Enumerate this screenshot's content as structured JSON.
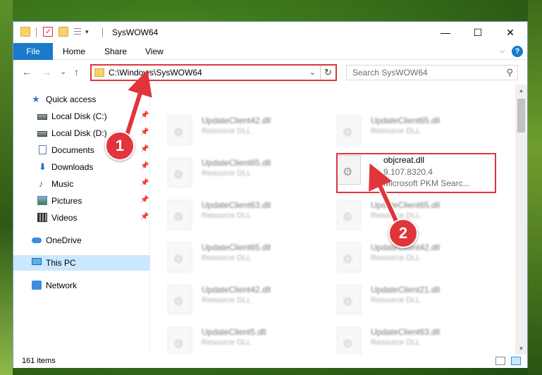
{
  "window": {
    "title": "SysWOW64"
  },
  "titlebar": {
    "minimize": "—",
    "maximize": "☐",
    "close": "✕",
    "qa_dropdown": "▾"
  },
  "ribbon": {
    "tabs": [
      "File",
      "Home",
      "Share",
      "View"
    ],
    "expand": "⌵",
    "help": "?"
  },
  "nav": {
    "back": "←",
    "forward": "→",
    "recent": "⌄",
    "up": "↑"
  },
  "address": {
    "path": "C:\\Windows\\SysWOW64",
    "dropdown": "⌄",
    "refresh": "↻"
  },
  "search": {
    "placeholder": "Search SysWOW64",
    "icon": "⚲"
  },
  "sidebar": {
    "items": [
      {
        "label": "Quick access"
      },
      {
        "label": "Local Disk (C:)"
      },
      {
        "label": "Local Disk (D:)"
      },
      {
        "label": "Documents"
      },
      {
        "label": "Downloads"
      },
      {
        "label": "Music"
      },
      {
        "label": "Pictures"
      },
      {
        "label": "Videos"
      },
      {
        "label": "OneDrive"
      },
      {
        "label": "This PC"
      },
      {
        "label": "Network"
      }
    ],
    "pin": "📌"
  },
  "files": [
    {
      "name": "UpdateClient42.dll",
      "type": "Resource DLL"
    },
    {
      "name": "UpdateClient65.dll",
      "type": "Resource DLL"
    },
    {
      "name": "UpdateClient65.dll",
      "type": "Resource DLL"
    },
    {
      "name": "objcreat.dll",
      "version": "9.107.8320.4",
      "desc": "Microsoft PKM Searc..."
    },
    {
      "name": "UpdateClient63.dll",
      "type": "Resource DLL"
    },
    {
      "name": "UpdateClient65.dll",
      "type": "Resource DLL"
    },
    {
      "name": "UpdateClient65.dll",
      "type": "Resource DLL"
    },
    {
      "name": "UpdateClient42.dll",
      "type": "Resource DLL"
    },
    {
      "name": "UpdateClient42.dll",
      "type": "Resource DLL"
    },
    {
      "name": "UpdateClient21.dll",
      "type": "Resource DLL"
    },
    {
      "name": "UpdateClient5.dll",
      "type": "Resource DLL"
    },
    {
      "name": "UpdateClient63.dll",
      "type": "Resource DLL"
    }
  ],
  "scrollbar": {
    "up": "▲",
    "down": "▼"
  },
  "status": {
    "items": "161 items"
  },
  "annotations": {
    "badge1": "1",
    "badge2": "2"
  },
  "colors": {
    "accent": "#1979ca",
    "highlight": "#e0353b",
    "selected": "#cce8ff"
  }
}
